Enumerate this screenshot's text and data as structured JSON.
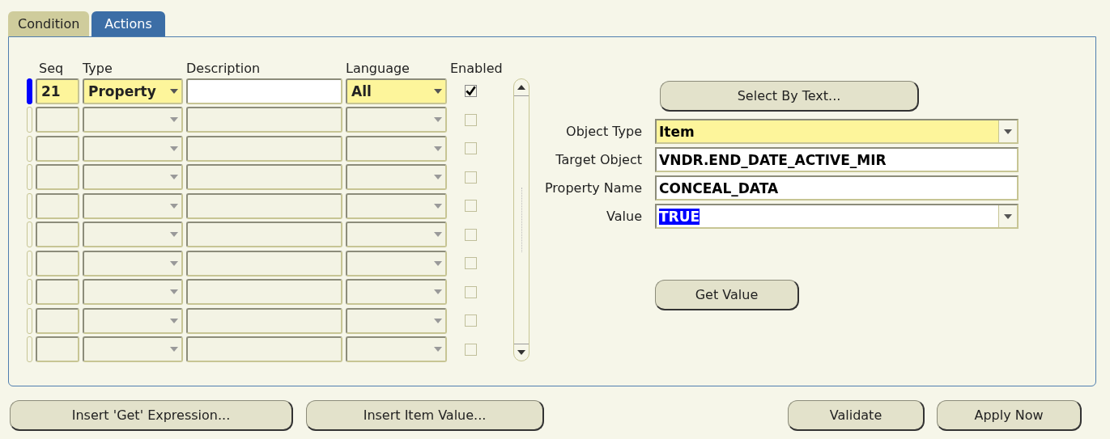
{
  "tabs": [
    {
      "label": "Condition",
      "selected": false
    },
    {
      "label": "Actions",
      "selected": true
    }
  ],
  "actions_table": {
    "columns": [
      "Seq",
      "Type",
      "Description",
      "Language",
      "Enabled"
    ],
    "rows": [
      {
        "current": true,
        "seq": "21",
        "type": "Property",
        "description": "",
        "language": "All",
        "enabled": true
      },
      {
        "current": false,
        "enabled": false
      },
      {
        "current": false,
        "enabled": false
      },
      {
        "current": false,
        "enabled": false
      },
      {
        "current": false,
        "enabled": false
      },
      {
        "current": false,
        "enabled": false
      },
      {
        "current": false,
        "enabled": false
      },
      {
        "current": false,
        "enabled": false
      },
      {
        "current": false,
        "enabled": false
      },
      {
        "current": false,
        "enabled": false
      }
    ]
  },
  "select_by_text_button": "Select By Text...",
  "properties": [
    {
      "label": "Object Type",
      "value": "Item",
      "kind": "dropdown",
      "required": true,
      "text_selected": false
    },
    {
      "label": "Target Object",
      "value": "VNDR.END_DATE_ACTIVE_MIR",
      "kind": "text",
      "required": false,
      "text_selected": false
    },
    {
      "label": "Property Name",
      "value": "CONCEAL_DATA",
      "kind": "text",
      "required": false,
      "text_selected": false
    },
    {
      "label": "Value",
      "value": "TRUE",
      "kind": "dropdown",
      "required": false,
      "text_selected": true
    }
  ],
  "get_value_button": "Get Value",
  "bottom_buttons_left": [
    "Insert 'Get' Expression...",
    "Insert Item Value..."
  ],
  "bottom_buttons_right": [
    "Validate",
    "Apply Now"
  ]
}
